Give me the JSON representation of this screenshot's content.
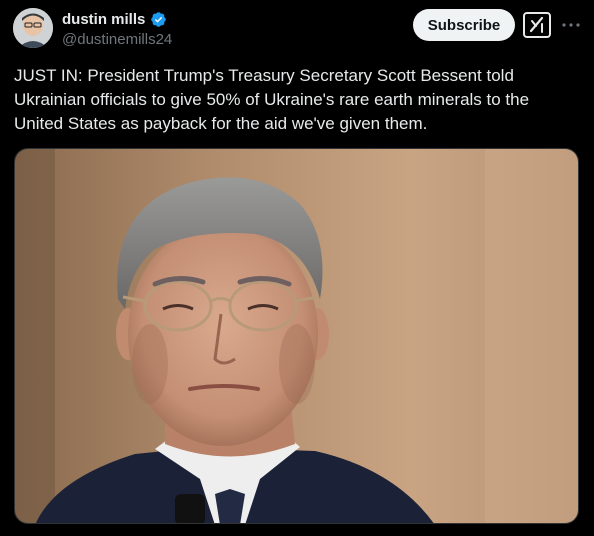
{
  "author": {
    "display_name": "dustin mills",
    "handle": "@dustinemills24",
    "verified_icon": "verified-badge-icon"
  },
  "actions": {
    "subscribe_label": "Subscribe",
    "grok_icon": "grok-icon",
    "more_icon": "more-options-icon"
  },
  "post": {
    "text": "JUST IN: President Trump's Treasury Secretary Scott Bessent told Ukrainian officials to give 50% of Ukraine's rare earth minerals to the United States as payback for the aid we've given them."
  },
  "media": {
    "description_icon": "photo-man-in-suit"
  },
  "colors": {
    "background": "#000000",
    "text_primary": "#e7e9ea",
    "text_secondary": "#71767b",
    "verified_blue": "#1d9bf0",
    "subscribe_bg": "#eff3f4"
  }
}
